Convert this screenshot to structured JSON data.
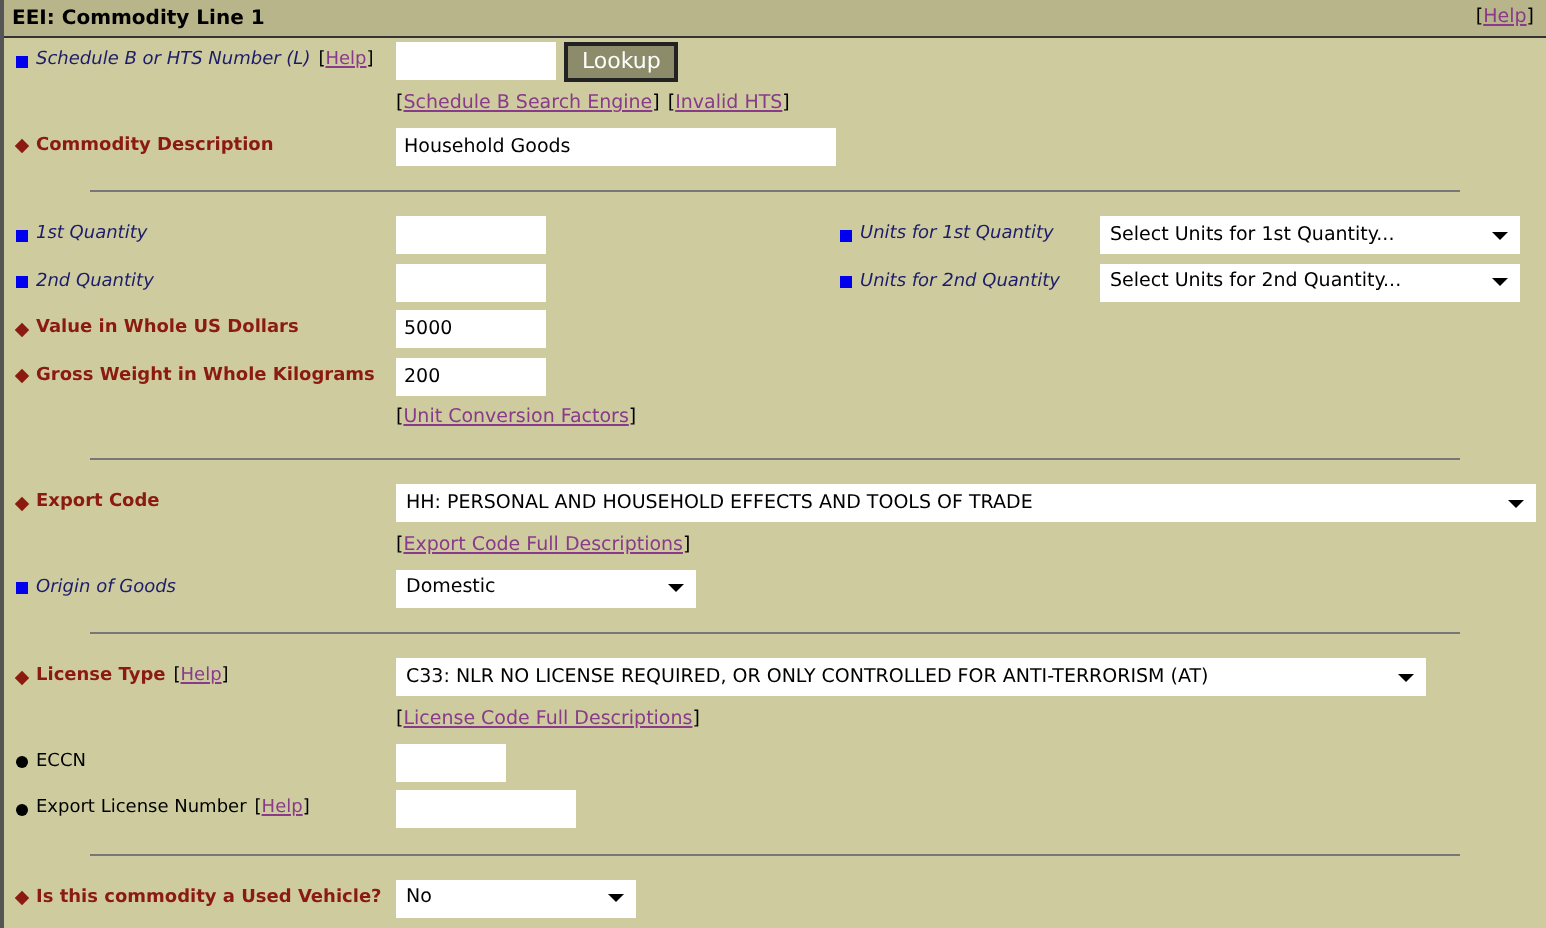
{
  "header": {
    "title": "EEI: Commodity Line 1",
    "help": {
      "before": "[",
      "text": "Help",
      "after": "]"
    }
  },
  "rows": [
    {
      "kind": "field",
      "label": {
        "kind": "optional",
        "text": "Schedule B or HTS Number (L)"
      },
      "help": {
        "before": "[",
        "text": "Help",
        "after": "]"
      },
      "control": {
        "kind": "input"
      },
      "button": "Lookup"
    },
    {
      "kind": "links",
      "links": [
        {
          "before": "[",
          "text": "Schedule B Search Engine",
          "after": "]"
        },
        {
          "before": "[",
          "text": "Invalid HTS",
          "after": "]"
        }
      ]
    },
    {
      "kind": "field",
      "label": {
        "kind": "required",
        "text": "Commodity Description"
      },
      "control": {
        "kind": "input",
        "value": "Household Goods"
      }
    },
    {
      "kind": "divider"
    },
    {
      "kind": "field",
      "label": {
        "kind": "optional",
        "text": "1st Quantity"
      },
      "control": {
        "kind": "input"
      },
      "side": {
        "label": {
          "kind": "optional",
          "text": "Units for 1st Quantity"
        },
        "control": {
          "kind": "select",
          "value": "Select Units for 1st Quantity..."
        }
      }
    },
    {
      "kind": "field",
      "label": {
        "kind": "optional",
        "text": "2nd Quantity"
      },
      "control": {
        "kind": "input"
      },
      "side": {
        "label": {
          "kind": "optional",
          "text": "Units for 2nd Quantity"
        },
        "control": {
          "kind": "select",
          "value": "Select Units for 2nd Quantity..."
        }
      }
    },
    {
      "kind": "field",
      "label": {
        "kind": "required",
        "text": "Value in Whole US Dollars"
      },
      "control": {
        "kind": "input",
        "value": "5000"
      }
    },
    {
      "kind": "field",
      "label": {
        "kind": "required",
        "text": "Gross Weight in Whole Kilograms"
      },
      "control": {
        "kind": "input",
        "value": "200"
      }
    },
    {
      "kind": "links",
      "links": [
        {
          "before": "[",
          "text": "Unit Conversion Factors",
          "after": "]"
        }
      ]
    },
    {
      "kind": "divider"
    },
    {
      "kind": "field",
      "label": {
        "kind": "required",
        "text": "Export Code"
      },
      "control": {
        "kind": "select",
        "value": "HH: PERSONAL AND HOUSEHOLD EFFECTS AND TOOLS OF TRADE"
      }
    },
    {
      "kind": "links",
      "links": [
        {
          "before": "[",
          "text": "Export Code Full Descriptions",
          "after": "]"
        }
      ]
    },
    {
      "kind": "field",
      "label": {
        "kind": "optional",
        "text": "Origin of Goods"
      },
      "control": {
        "kind": "select",
        "value": "Domestic"
      }
    },
    {
      "kind": "divider"
    },
    {
      "kind": "field",
      "label": {
        "kind": "required",
        "text": "License Type"
      },
      "help": {
        "before": "[",
        "text": "Help",
        "after": "]"
      },
      "control": {
        "kind": "select",
        "value": "C33: NLR NO LICENSE REQUIRED, OR ONLY CONTROLLED FOR ANTI-TERRORISM (AT)"
      }
    },
    {
      "kind": "links",
      "links": [
        {
          "before": "[",
          "text": "License Code Full Descriptions",
          "after": "]"
        }
      ]
    },
    {
      "kind": "field",
      "label": {
        "kind": "conditional",
        "text": "ECCN"
      },
      "control": {
        "kind": "input"
      }
    },
    {
      "kind": "field",
      "label": {
        "kind": "conditional",
        "text": "Export License Number"
      },
      "help": {
        "before": "[",
        "text": "Help",
        "after": "]"
      },
      "control": {
        "kind": "input"
      }
    },
    {
      "kind": "divider"
    },
    {
      "kind": "field",
      "label": {
        "kind": "required",
        "text": "Is this commodity a Used Vehicle?"
      },
      "control": {
        "kind": "select",
        "value": "No"
      }
    }
  ]
}
